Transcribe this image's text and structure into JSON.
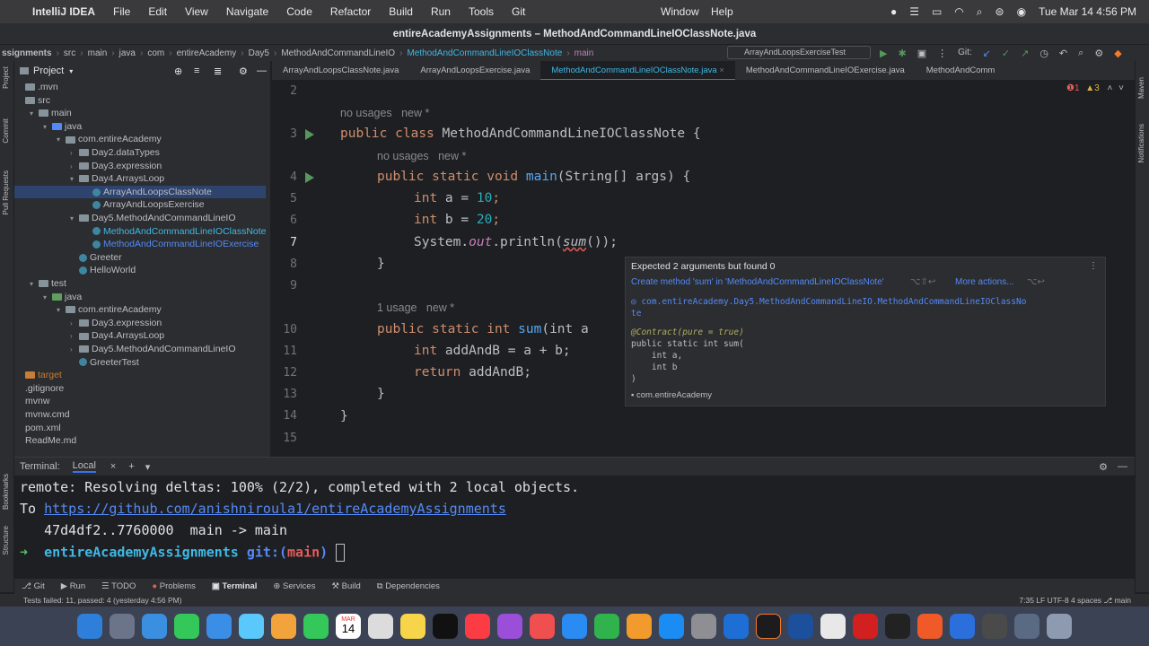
{
  "menubar": {
    "app": "IntelliJ IDEA",
    "items": [
      "File",
      "Edit",
      "View",
      "Navigate",
      "Code",
      "Refactor",
      "Build",
      "Run",
      "Tools",
      "Git"
    ],
    "right_items": [
      "Window",
      "Help"
    ],
    "datetime": "Tue Mar 14  4:56 PM"
  },
  "window_title": "entireAcademyAssignments – MethodAndCommandLineIOClassNote.java",
  "breadcrumbs": [
    "ssignments",
    "src",
    "main",
    "java",
    "com",
    "entireAcademy",
    "Day5",
    "MethodAndCommandLineIO",
    "MethodAndCommandLineIOClassNote",
    "main"
  ],
  "run_config": "ArrayAndLoopsExerciseTest",
  "git_label": "Git:",
  "project_panel": {
    "title": "Project",
    "rows": [
      {
        "label": ".mvn",
        "indent": 0,
        "type": "folder",
        "arrow": ""
      },
      {
        "label": "src",
        "indent": 0,
        "type": "folder",
        "arrow": ""
      },
      {
        "label": "main",
        "indent": 1,
        "type": "folder",
        "arrow": "▾"
      },
      {
        "label": "java",
        "indent": 2,
        "type": "folder-blue",
        "arrow": "▾"
      },
      {
        "label": "com.entireAcademy",
        "indent": 3,
        "type": "folder",
        "arrow": "▾"
      },
      {
        "label": "Day2.dataTypes",
        "indent": 4,
        "type": "folder",
        "arrow": "›"
      },
      {
        "label": "Day3.expression",
        "indent": 4,
        "type": "folder",
        "arrow": "›"
      },
      {
        "label": "Day4.ArraysLoop",
        "indent": 4,
        "type": "folder",
        "arrow": "▾"
      },
      {
        "label": "ArrayAndLoopsClassNote",
        "indent": 5,
        "type": "class",
        "arrow": "",
        "selected": true
      },
      {
        "label": "ArrayAndLoopsExercise",
        "indent": 5,
        "type": "class",
        "arrow": ""
      },
      {
        "label": "Day5.MethodAndCommandLineIO",
        "indent": 4,
        "type": "folder",
        "arrow": "▾"
      },
      {
        "label": "MethodAndCommandLineIOClassNote",
        "indent": 5,
        "type": "class-cyan",
        "arrow": ""
      },
      {
        "label": "MethodAndCommandLineIOExercise",
        "indent": 5,
        "type": "class-blue",
        "arrow": ""
      },
      {
        "label": "Greeter",
        "indent": 4,
        "type": "class",
        "arrow": ""
      },
      {
        "label": "HelloWorld",
        "indent": 4,
        "type": "class",
        "arrow": ""
      },
      {
        "label": "test",
        "indent": 1,
        "type": "folder",
        "arrow": "▾"
      },
      {
        "label": "java",
        "indent": 2,
        "type": "folder-green",
        "arrow": "▾"
      },
      {
        "label": "com.entireAcademy",
        "indent": 3,
        "type": "folder",
        "arrow": "▾"
      },
      {
        "label": "Day3.expression",
        "indent": 4,
        "type": "folder",
        "arrow": "›"
      },
      {
        "label": "Day4.ArraysLoop",
        "indent": 4,
        "type": "folder",
        "arrow": "›"
      },
      {
        "label": "Day5.MethodAndCommandLineIO",
        "indent": 4,
        "type": "folder",
        "arrow": "›"
      },
      {
        "label": "GreeterTest",
        "indent": 4,
        "type": "class",
        "arrow": ""
      },
      {
        "label": "target",
        "indent": 0,
        "type": "folder-orange",
        "arrow": ""
      },
      {
        "label": ".gitignore",
        "indent": 0,
        "type": "file",
        "arrow": ""
      },
      {
        "label": "mvnw",
        "indent": 0,
        "type": "file",
        "arrow": ""
      },
      {
        "label": "mvnw.cmd",
        "indent": 0,
        "type": "file",
        "arrow": ""
      },
      {
        "label": "pom.xml",
        "indent": 0,
        "type": "file",
        "arrow": ""
      },
      {
        "label": "ReadMe.md",
        "indent": 0,
        "type": "file",
        "arrow": ""
      }
    ]
  },
  "tabs": [
    {
      "label": "ArrayAndLoopsClassNote.java",
      "active": false
    },
    {
      "label": "ArrayAndLoopsExercise.java",
      "active": false
    },
    {
      "label": "MethodAndCommandLineIOClassNote.java",
      "active": true
    },
    {
      "label": "MethodAndCommandLineIOExercise.java",
      "active": false
    },
    {
      "label": "MethodAndComm",
      "active": false
    }
  ],
  "inspection_counts": {
    "errors": "1",
    "warnings": "3"
  },
  "editor": {
    "line_numbers": [
      "2",
      "3",
      "4",
      "5",
      "6",
      "7",
      "8",
      "9",
      "10",
      "11",
      "12",
      "13",
      "14",
      "15"
    ],
    "hint_no_usages": "no usages",
    "hint_new": "new *",
    "hint_1_usage": "1 usage",
    "line3": {
      "kw1": "public",
      "kw2": "class",
      "name": "MethodAndCommandLineIOClassNote",
      "rest": " {"
    },
    "line4": {
      "kw": "public static void",
      "fn": "main",
      "rest": "(String[] args) {"
    },
    "line5": {
      "kw": "int",
      "rest": " a = ",
      "num": "10",
      "end": ";"
    },
    "line6": {
      "kw": "int",
      "rest": " b = ",
      "num": "20",
      "end": ";"
    },
    "line7": {
      "pre": "System.",
      "st": "out",
      "mid": ".println(",
      "call": "sum",
      "end": "());"
    },
    "line8": "}",
    "line10": {
      "kw": "public static int",
      "fn": "sum",
      "rest": "(int a"
    },
    "line11": {
      "kw": "int",
      "rest": " addAndB = a + b;"
    },
    "line12": {
      "kw": "return",
      "rest": " addAndB;"
    },
    "line13": "}",
    "line14": "}"
  },
  "popup": {
    "error": "Expected 2 arguments but found 0",
    "create_method": "Create method 'sum' in 'MethodAndCommandLineIOClassNote'",
    "create_shortcut": "⌥⇧↩",
    "more_actions": "More actions...",
    "more_shortcut": "⌥↩",
    "qualified": "com.entireAcademy.Day5.MethodAndCommandLineIO.MethodAndCommandLineIOClassNo",
    "qualified_cont": "te",
    "contract": "@Contract(pure = true)",
    "sig1": "public static int sum(",
    "sig2": "    int a,",
    "sig3": "    int b",
    "sig4": ")",
    "package": "com.entireAcademy"
  },
  "terminal": {
    "title": "Terminal:",
    "tab": "Local",
    "lines": [
      "remote: Resolving deltas: 100% (2/2), completed with 2 local objects.",
      "To ",
      "   47d4df2..7760000  main -> main",
      ""
    ],
    "url": "https://github.com/anishniroula1/entireAcademyAssignments",
    "prompt_dir": "entireAcademyAssignments",
    "prompt_git": " git:(",
    "prompt_branch": "main",
    "prompt_end": ")"
  },
  "toolwindows": [
    "Git",
    "Run",
    "TODO",
    "Problems",
    "Terminal",
    "Services",
    "Build",
    "Dependencies"
  ],
  "status": {
    "left": "Tests failed: 11, passed: 4 (yesterday 4:56 PM)",
    "right": "7:35   LF   UTF-8   4 spaces   ⎇ main"
  },
  "dock": {
    "calendar_day": "14",
    "calendar_month": "MAR"
  },
  "left_strip_labels": [
    "Project",
    "Commit",
    "Pull Requests",
    "Bookmarks",
    "Structure"
  ],
  "right_strip_labels": [
    "Maven",
    "Notifications"
  ]
}
